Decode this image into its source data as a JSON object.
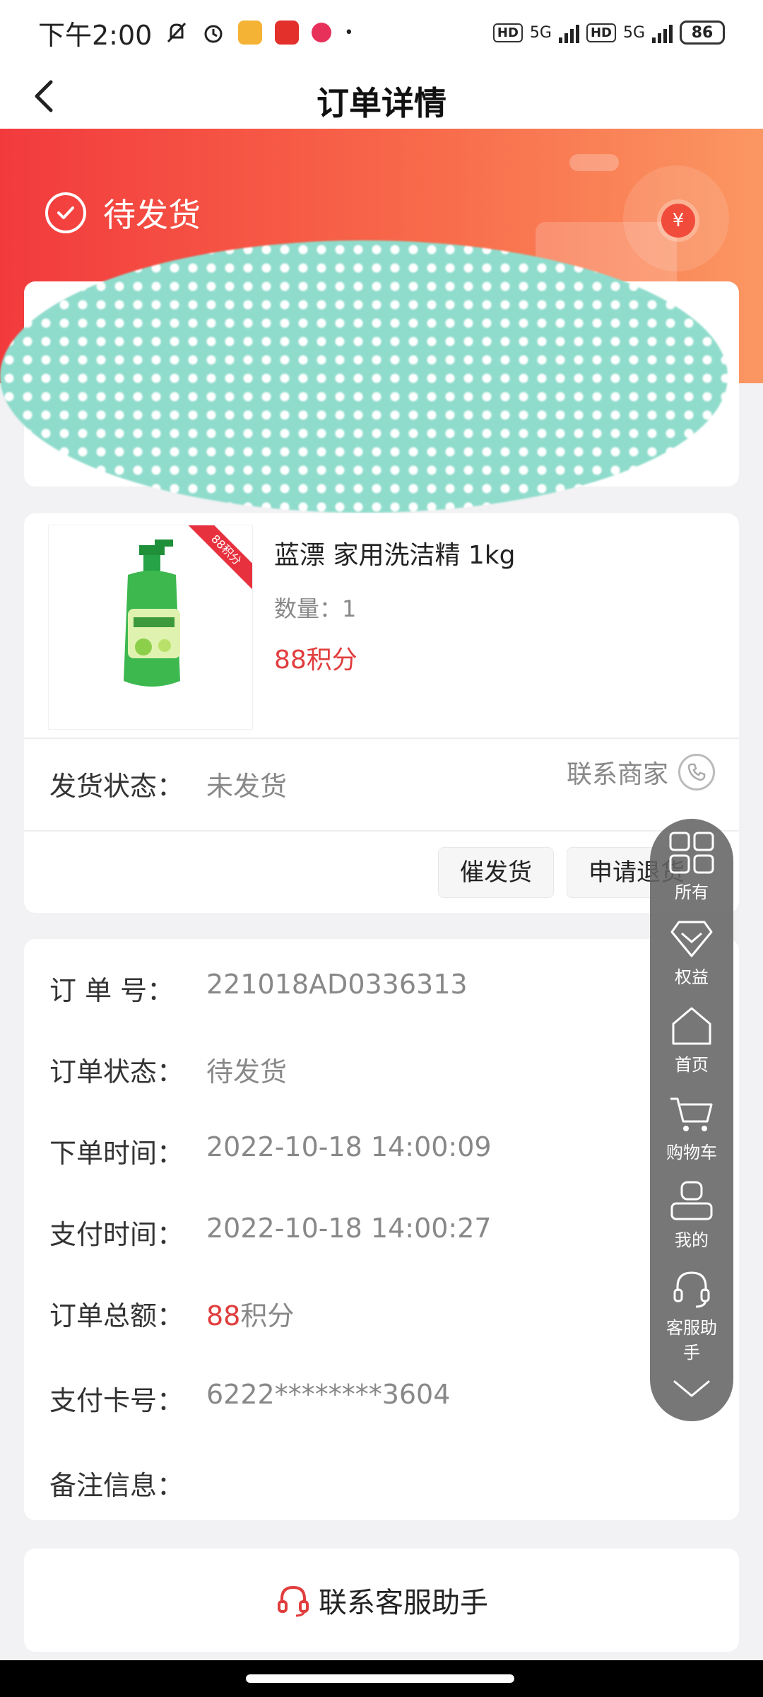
{
  "status_bar": {
    "time": "下午2:00",
    "network_1": "5G",
    "network_2": "5G",
    "hd_1": "HD",
    "hd_2": "HD",
    "battery": "86"
  },
  "nav": {
    "title": "订单详情"
  },
  "header": {
    "status": "待发货",
    "coin_symbol": "¥"
  },
  "product": {
    "ribbon": "88积分",
    "name": "蓝漂 家用洗洁精 1kg",
    "quantity": "数量：1",
    "points": "88积分",
    "ship_label": "发货状态：",
    "ship_value": "未发货",
    "contact_merchant": "联系商家",
    "urge_button": "催发货",
    "refund_button": "申请退货"
  },
  "details": {
    "order_no_label": "订 单 号：",
    "order_no": "221018AD0336313",
    "order_status_label": "订单状态：",
    "order_status": "待发货",
    "order_time_label": "下单时间：",
    "order_time": "2022-10-18 14:00:09",
    "pay_time_label": "支付时间：",
    "pay_time": "2022-10-18 14:00:27",
    "total_label": "订单总额：",
    "total_value": "88",
    "total_unit": "积分",
    "card_label": "支付卡号：",
    "card_no": "6222********3604",
    "remark_label": "备注信息："
  },
  "customer_service": {
    "label": "联系客服助手"
  },
  "float_menu": {
    "all": "所有",
    "benefits": "权益",
    "home": "首页",
    "cart": "购物车",
    "mine": "我的",
    "assistant_1": "客服助",
    "assistant_2": "手"
  },
  "colors": {
    "accent_red": "#e13d3d",
    "header_gradient_start": "#f23a3d",
    "header_gradient_end": "#fb9762",
    "redaction": "#8fdccc"
  }
}
